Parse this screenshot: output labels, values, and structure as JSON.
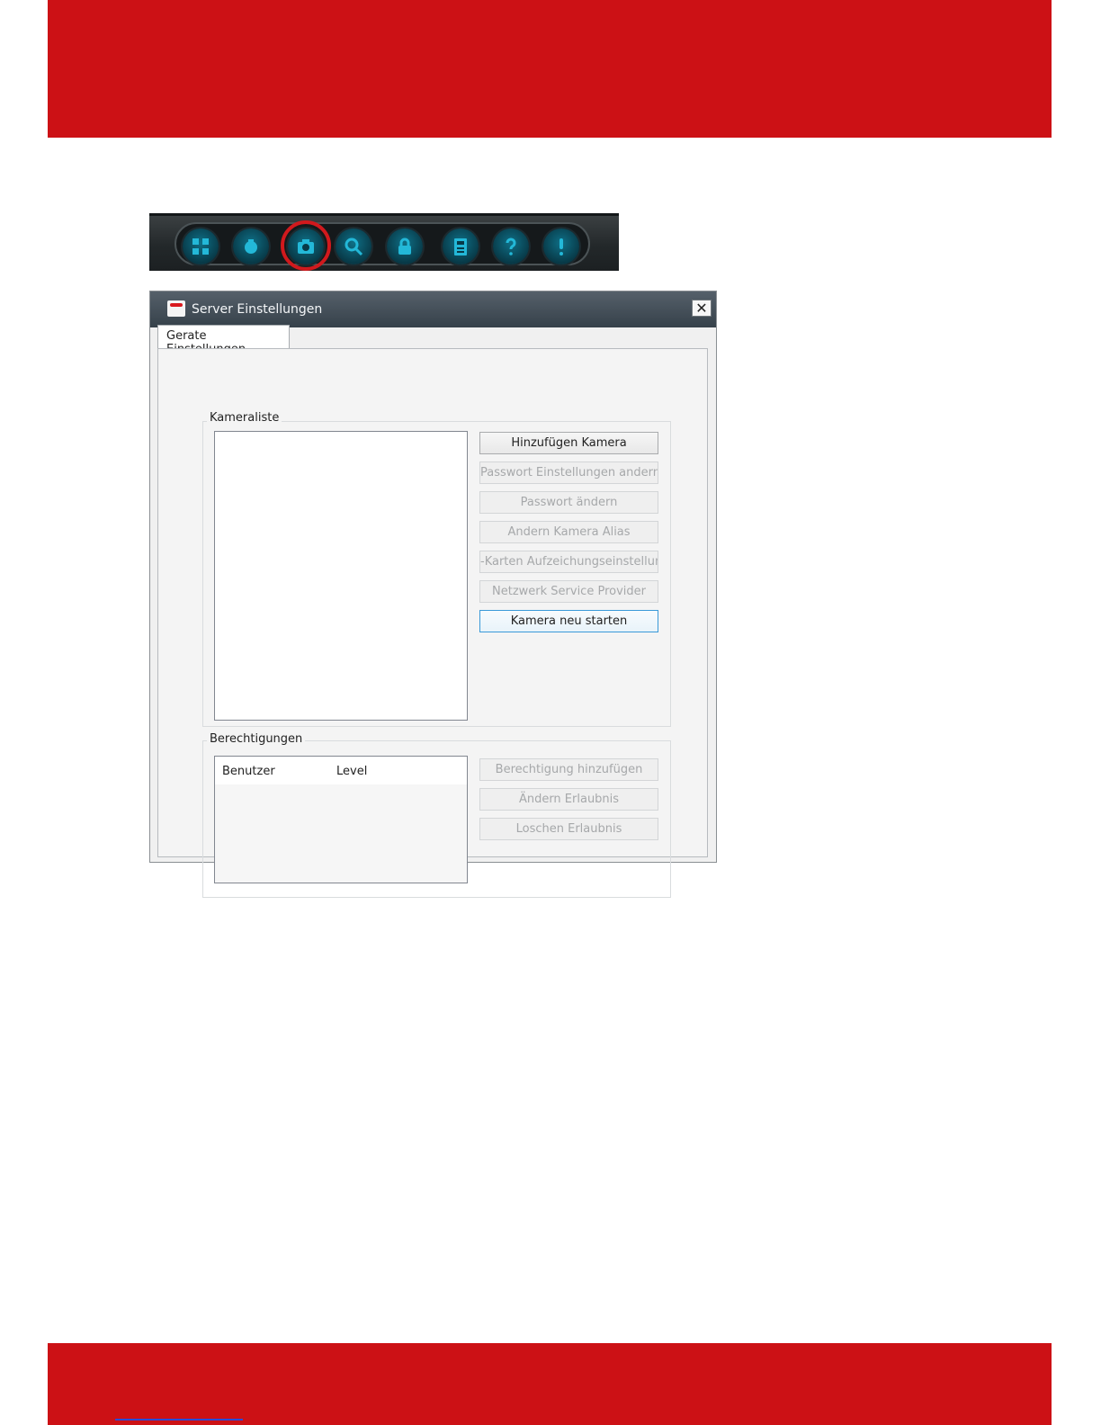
{
  "colors": {
    "brand_red": "#cc1115",
    "toolbar_dark": "#23282a",
    "icon_teal": "#0f6f86",
    "highlight_ring": "#d1191d",
    "focus_blue": "#3a9ad8"
  },
  "toolbar": {
    "icons": [
      "grid-icon",
      "record-icon",
      "camera-icon",
      "search-icon",
      "lock-icon",
      "calculator-icon",
      "help-icon",
      "info-icon"
    ],
    "highlighted": "camera-icon"
  },
  "dialog": {
    "title": "Server Einstellungen",
    "close_glyph": "✕",
    "tab_label": "Gerate Einstellungen",
    "camera_group": {
      "label": "Kameraliste",
      "buttons": [
        {
          "label": "Hinzufügen Kamera",
          "state": "enabled"
        },
        {
          "label": "Passwort Einstellungen andern",
          "state": "disabled"
        },
        {
          "label": "Passwort ändern",
          "state": "disabled"
        },
        {
          "label": "Andern Kamera Alias",
          "state": "disabled"
        },
        {
          "label": "-Karten Aufzeichungseinstellung",
          "state": "disabled"
        },
        {
          "label": "Netzwerk Service Provider",
          "state": "disabled"
        },
        {
          "label": "Kamera neu starten",
          "state": "focused"
        }
      ]
    },
    "permissions_group": {
      "label": "Berechtigungen",
      "columns": [
        "Benutzer",
        "Level"
      ],
      "buttons": [
        {
          "label": "Berechtigung hinzufügen",
          "state": "disabled"
        },
        {
          "label": "Ändern Erlaubnis",
          "state": "disabled"
        },
        {
          "label": "Loschen Erlaubnis",
          "state": "disabled"
        }
      ]
    }
  }
}
